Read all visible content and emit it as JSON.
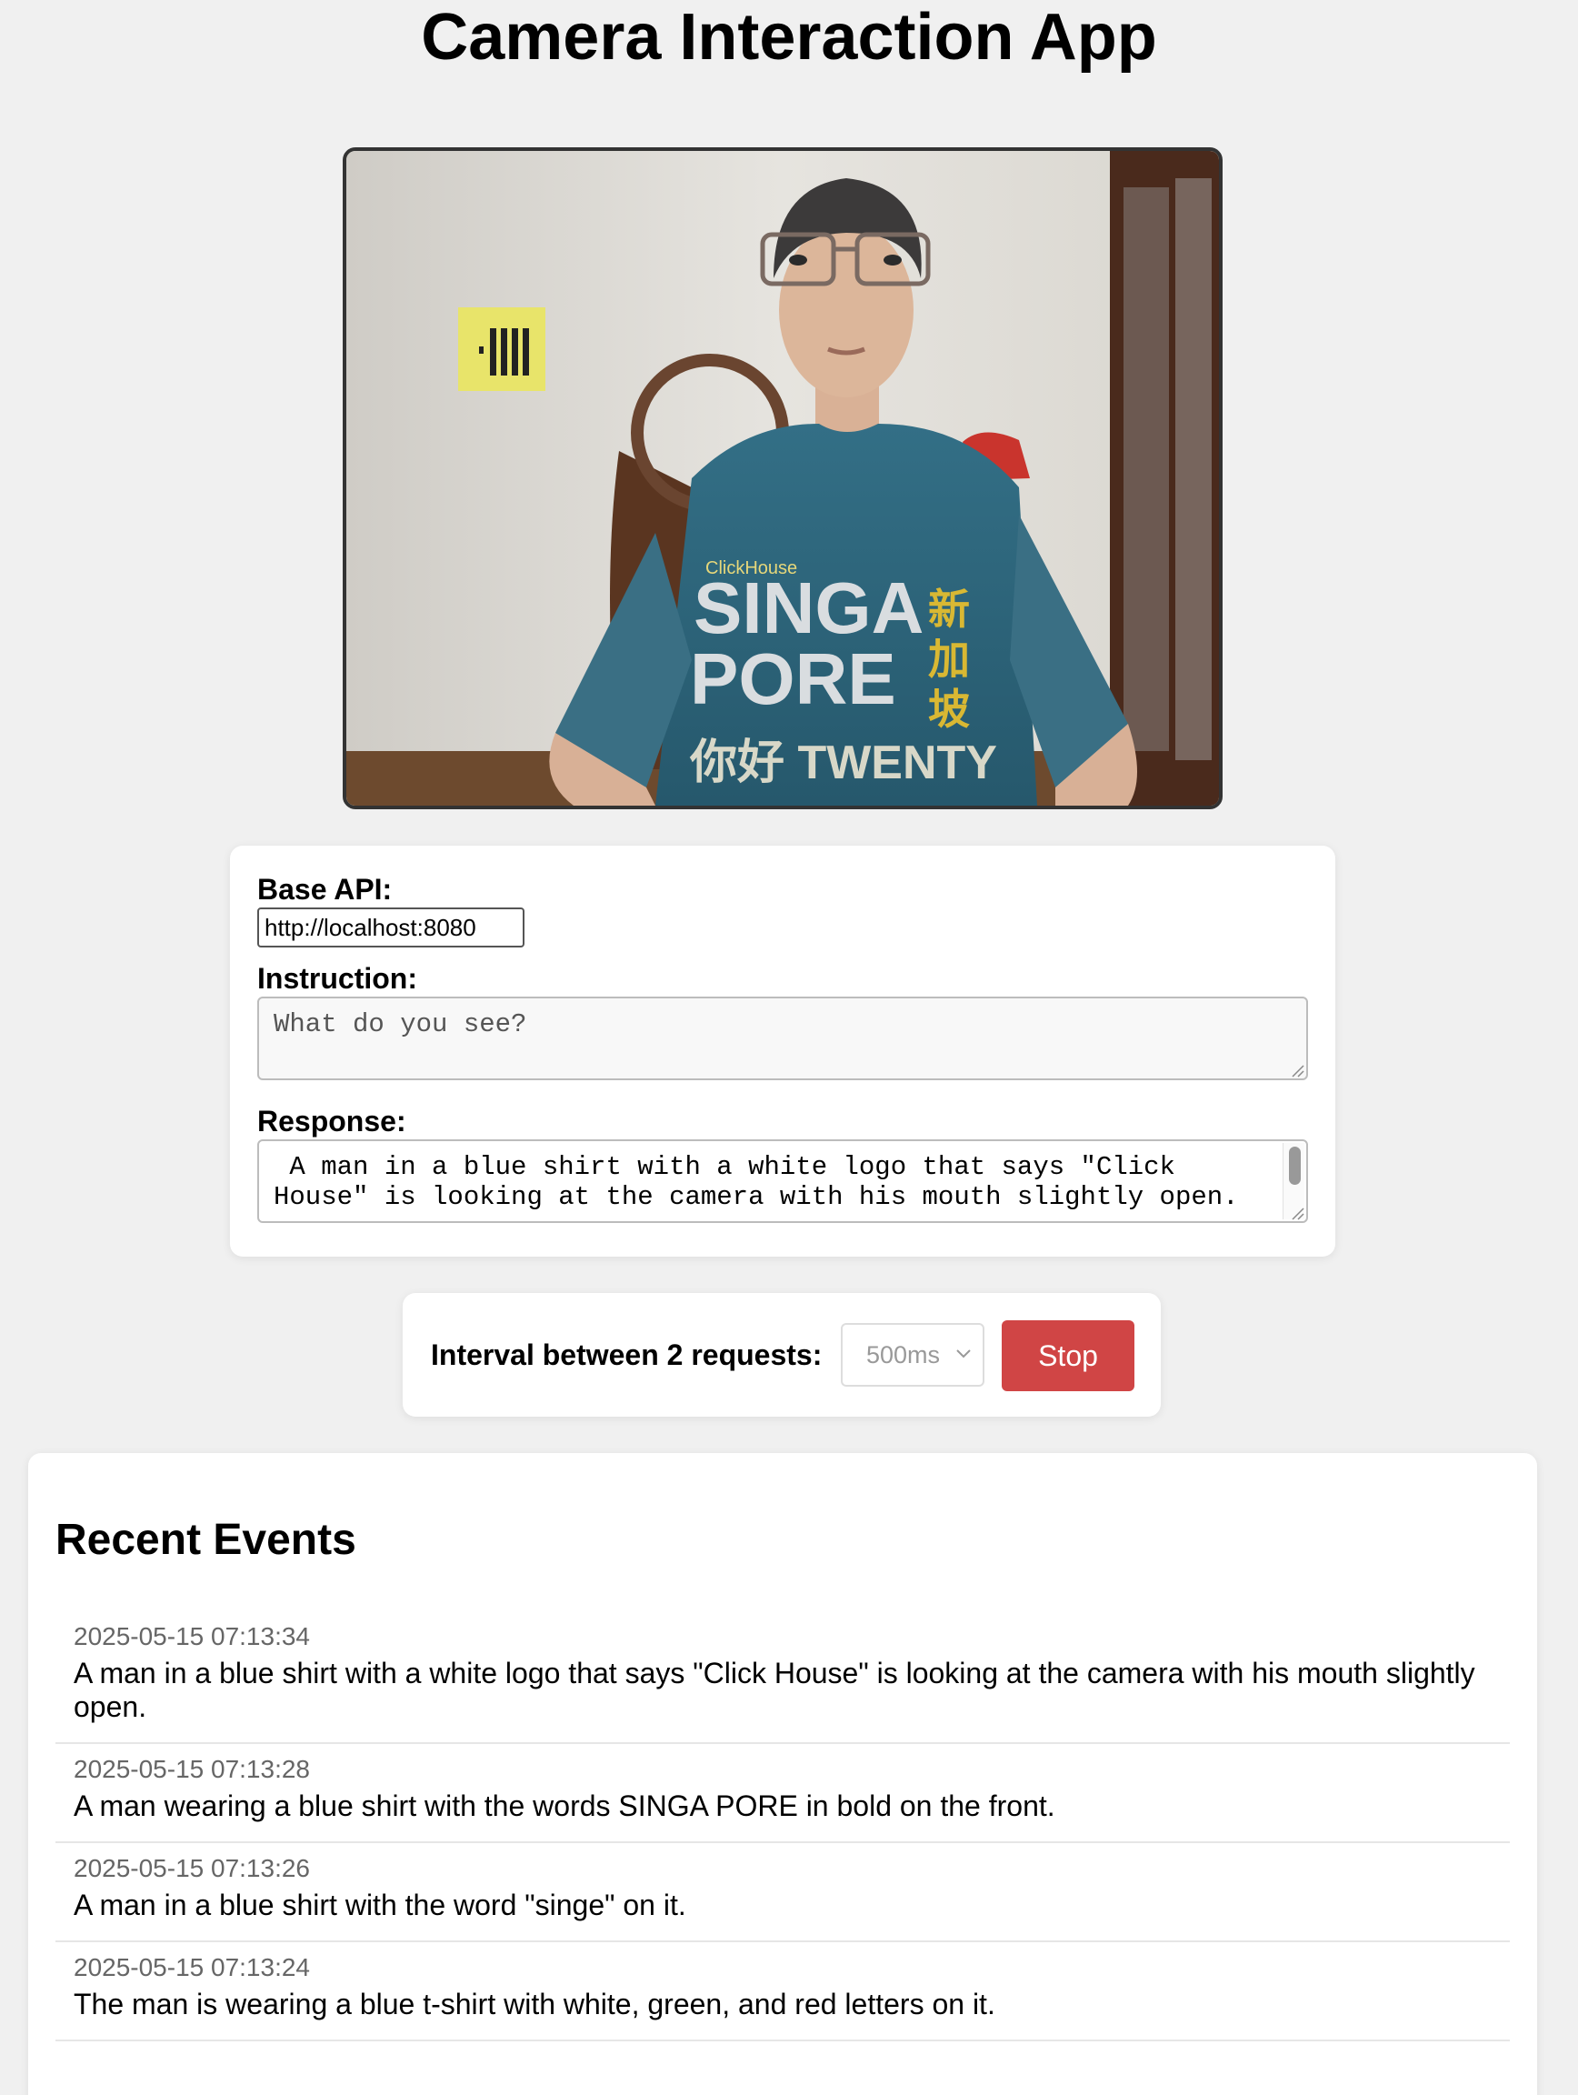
{
  "app": {
    "title": "Camera Interaction App"
  },
  "camera": {
    "shirt_logo": "ClickHouse",
    "shirt_text_line1": "SINGA",
    "shirt_text_line2": "PORE",
    "shirt_text_line3": "你好 TWENTY",
    "shirt_chinese": [
      "新",
      "加",
      "坡"
    ]
  },
  "form": {
    "base_api_label": "Base API:",
    "base_api_value": "http://localhost:8080",
    "instruction_label": "Instruction:",
    "instruction_placeholder": "What do you see?",
    "response_label": "Response:",
    "response_value": " A man in a blue shirt with a white logo that says \"Click House\" is looking at the camera with his mouth slightly open."
  },
  "interval": {
    "label": "Interval between 2 requests:",
    "selected": "500ms",
    "stop_label": "Stop"
  },
  "events": {
    "title": "Recent Events",
    "items": [
      {
        "time": "2025-05-15 07:13:34",
        "text": "A man in a blue shirt with a white logo that says \"Click House\" is looking at the camera with his mouth slightly open."
      },
      {
        "time": "2025-05-15 07:13:28",
        "text": "A man wearing a blue shirt with the words SINGA PORE in bold on the front."
      },
      {
        "time": "2025-05-15 07:13:26",
        "text": "A man in a blue shirt with the word \"singe\" on it."
      },
      {
        "time": "2025-05-15 07:13:24",
        "text": "The man is wearing a blue t-shirt with white, green, and red letters on it."
      }
    ]
  },
  "colors": {
    "page_background": "#f0f0f0",
    "stop_button": "#d04545",
    "shirt": "#2f6b82"
  }
}
